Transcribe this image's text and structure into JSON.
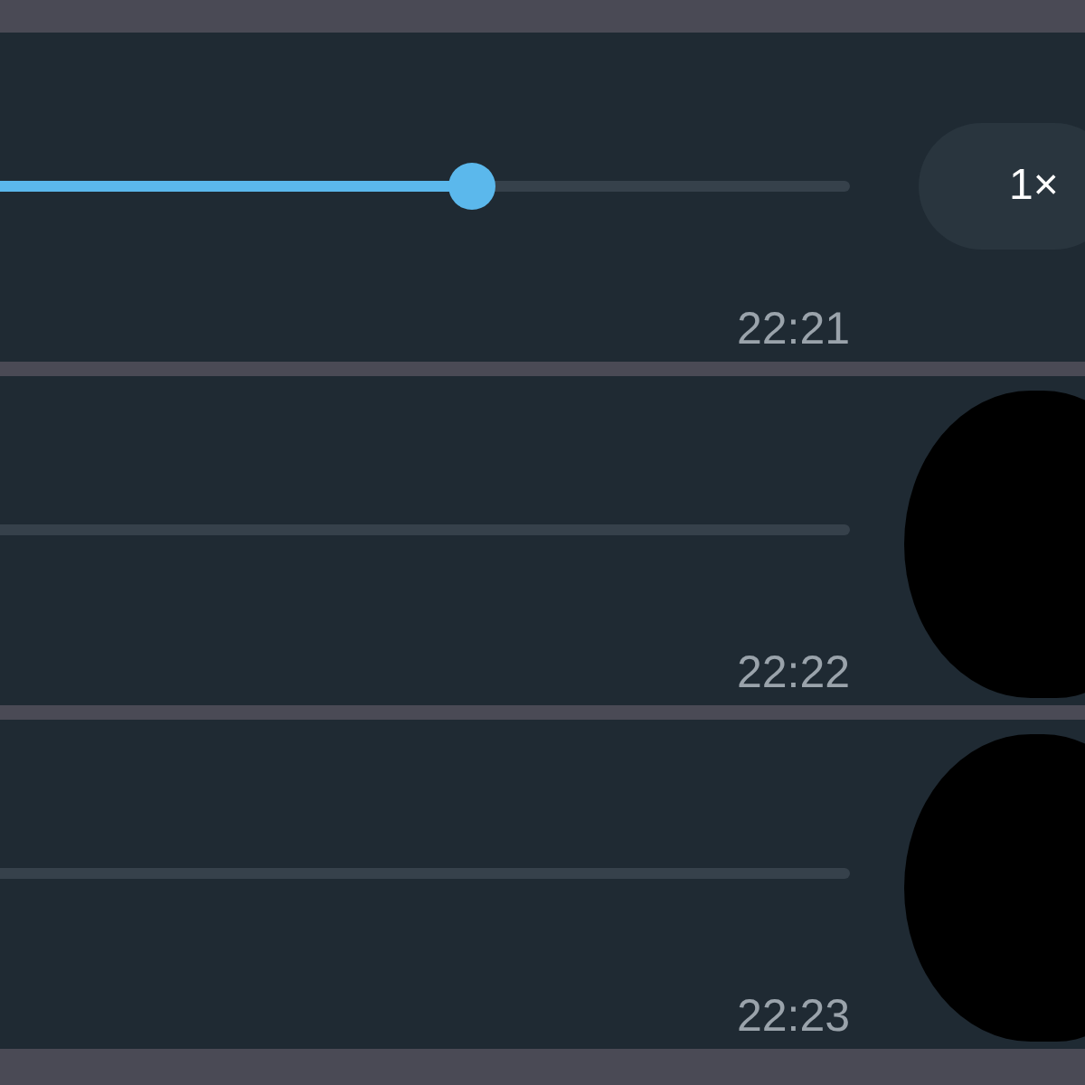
{
  "messages": [
    {
      "level": 0.555,
      "speed": "1×",
      "time": "22:21",
      "redacted": false
    },
    {
      "level": 0,
      "time": "22:22",
      "redacted": true
    },
    {
      "level": 0,
      "time": "22:23",
      "redacted": true
    }
  ]
}
